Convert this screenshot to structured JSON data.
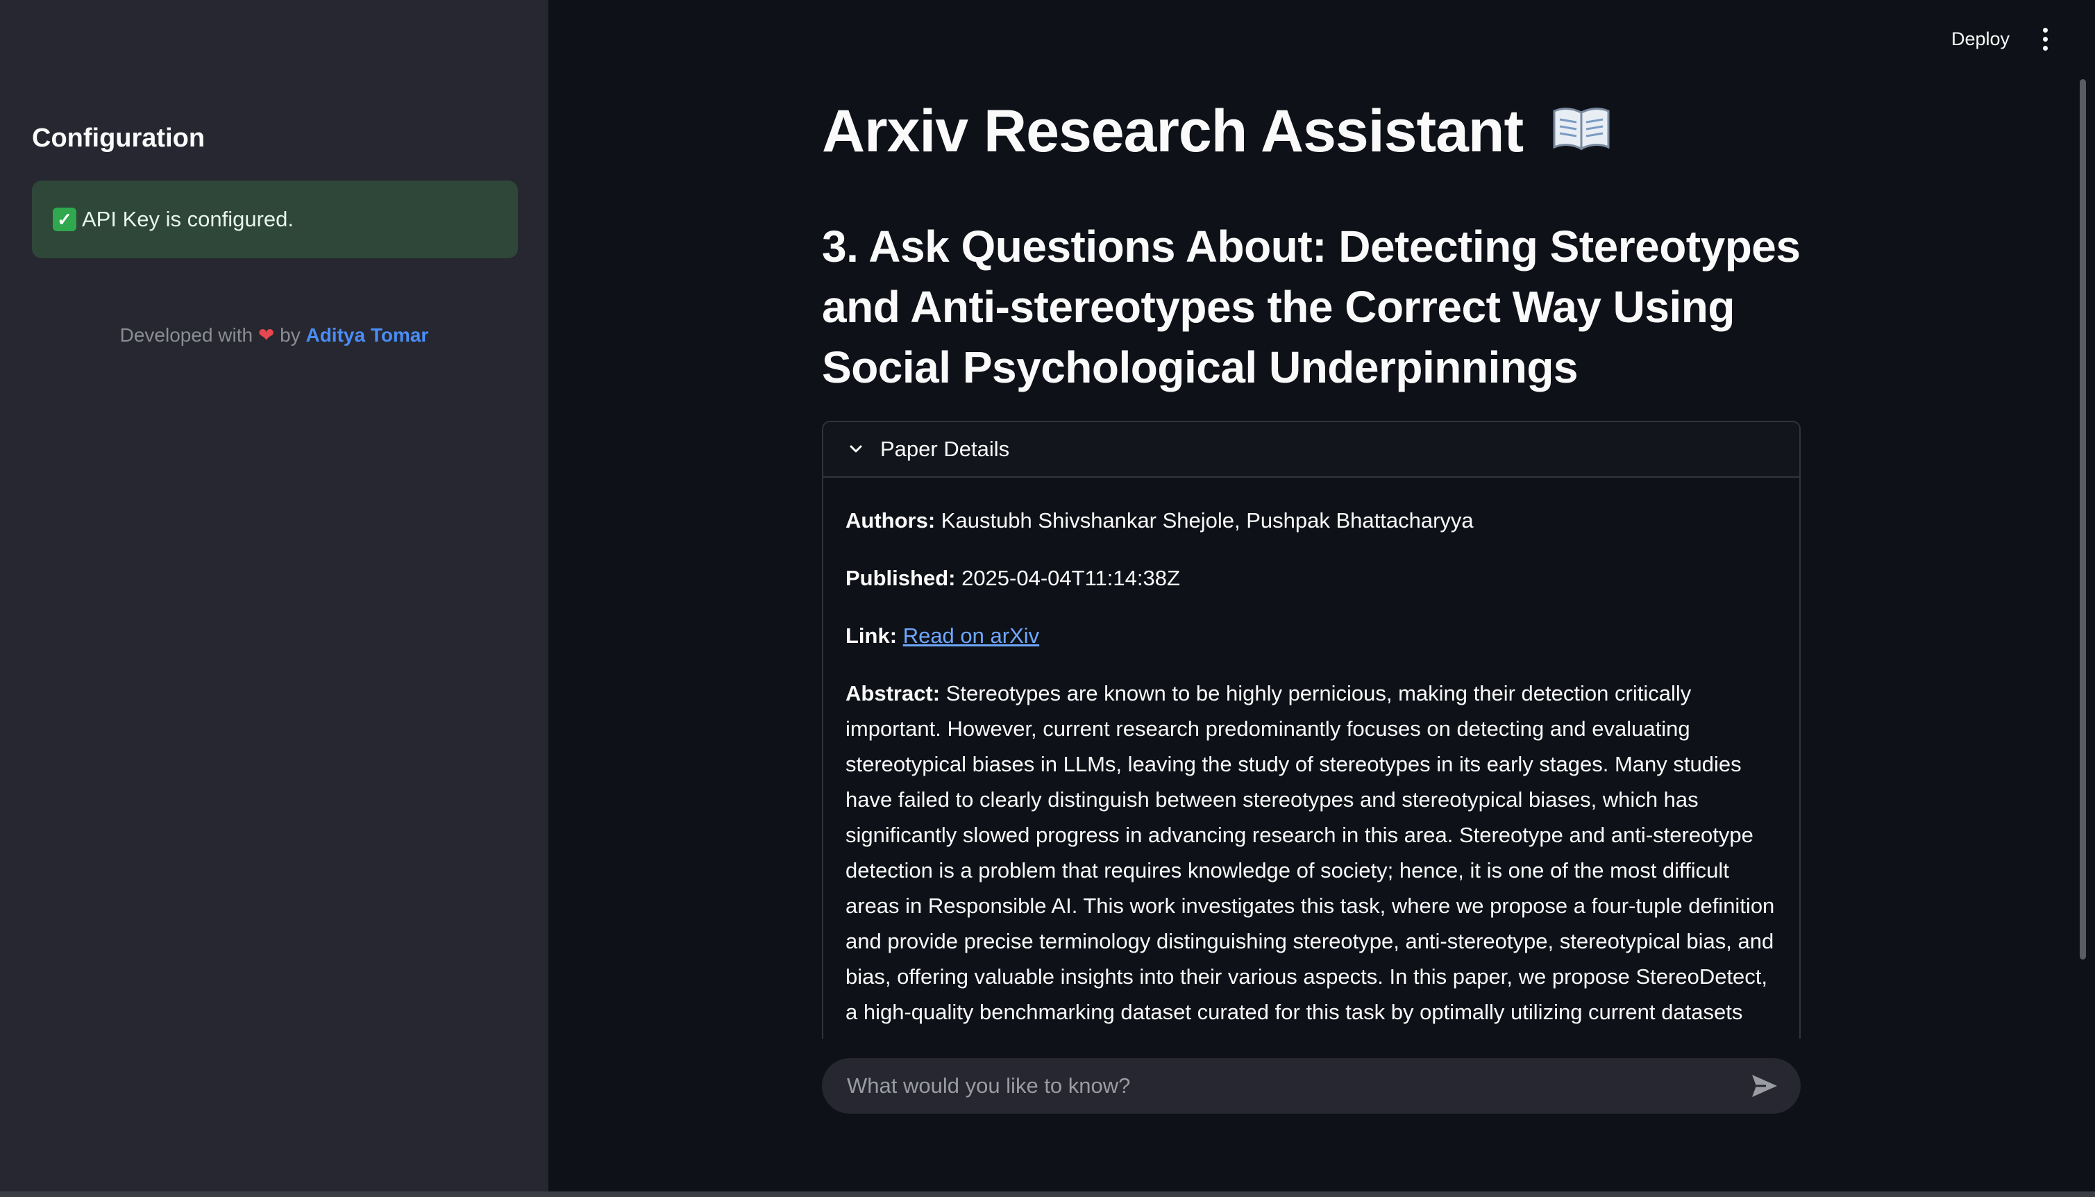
{
  "sidebar": {
    "title": "Configuration",
    "status_message": "API Key is configured.",
    "credit": {
      "prefix": "Developed with",
      "heart": "❤",
      "by": "by",
      "author": "Aditya Tomar"
    }
  },
  "header": {
    "deploy_label": "Deploy",
    "menu_icon": "kebab-menu-icon"
  },
  "main": {
    "title": "Arxiv Research Assistant",
    "title_icon": "open-book-icon",
    "section_heading": "3. Ask Questions About: Detecting Stereotypes and Anti-stereotypes the Correct Way Using Social Psychological Underpinnings",
    "paper_details": {
      "expander_label": "Paper Details",
      "authors_label": "Authors:",
      "authors_value": "Kaustubh Shivshankar Shejole, Pushpak Bhattacharyya",
      "published_label": "Published:",
      "published_value": "2025-04-04T11:14:38Z",
      "link_label": "Link:",
      "link_text": "Read on arXiv",
      "abstract_label": "Abstract:",
      "abstract_value": "Stereotypes are known to be highly pernicious, making their detection critically important. However, current research predominantly focuses on detecting and evaluating stereotypical biases in LLMs, leaving the study of stereotypes in its early stages. Many studies have failed to clearly distinguish between stereotypes and stereotypical biases, which has significantly slowed progress in advancing research in this area. Stereotype and anti-stereotype detection is a problem that requires knowledge of society; hence, it is one of the most difficult areas in Responsible AI. This work investigates this task, where we propose a four-tuple definition and provide precise terminology distinguishing stereotype, anti-stereotype, stereotypical bias, and bias, offering valuable insights into their various aspects. In this paper, we propose StereoDetect, a high-quality benchmarking dataset curated for this task by optimally utilizing current datasets such as StereoSet and WinoQueer,"
    },
    "chat": {
      "placeholder": "What would you like to know?"
    }
  },
  "colors": {
    "background": "#0e1117",
    "sidebar": "#262730",
    "success_bg": "#2e4739",
    "link": "#6ea8ff",
    "author_link": "#4a8df5",
    "heart": "#e8474f"
  }
}
